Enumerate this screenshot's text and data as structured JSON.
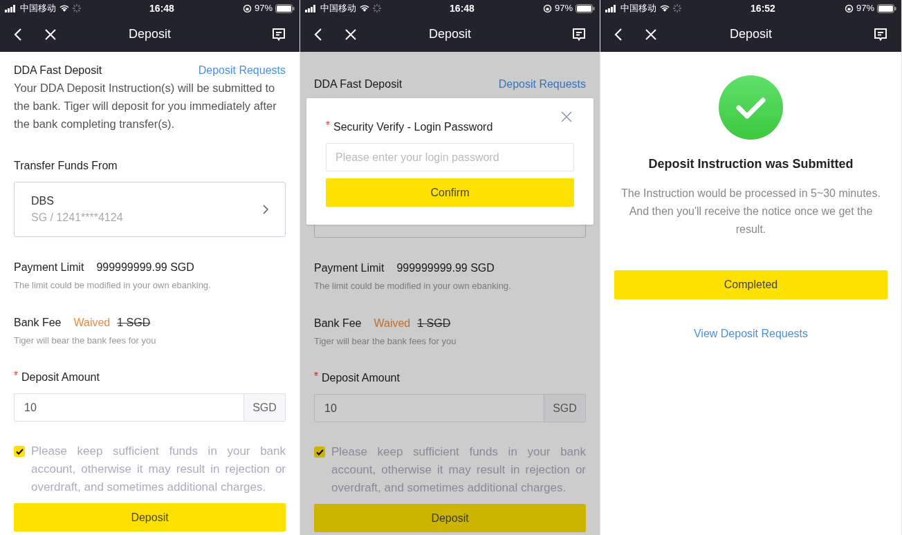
{
  "screens": [
    {
      "kind": "form",
      "status_bar": {
        "carrier": "中国移动",
        "time": "16:48",
        "battery": "97%"
      },
      "nav": {
        "title": "Deposit"
      },
      "header": {
        "title": "DDA Fast Deposit",
        "link": "Deposit Requests"
      },
      "description": "Your DDA Deposit Instruction(s) will be submitted to the bank. Tiger will deposit for you immediately after the bank completing transfer(s).",
      "transfer": {
        "label": "Transfer Funds From",
        "bank": "DBS",
        "account": "SG / 1241****4124"
      },
      "payment_limit": {
        "label": "Payment Limit",
        "value": "999999999.99 SGD",
        "note": "The limit could be modified in your own ebanking."
      },
      "bank_fee": {
        "label": "Bank Fee",
        "waived": "Waived",
        "original": "1 SGD",
        "note": "Tiger will bear the bank fees for you"
      },
      "amount": {
        "label": "Deposit Amount",
        "value": "10",
        "unit": "SGD"
      },
      "agreement": {
        "checked": true,
        "text": "Please keep sufficient funds in your bank account, otherwise it may result in rejection or overdraft, and sometimes additional charges."
      },
      "submit": "Deposit"
    },
    {
      "kind": "form",
      "status_bar": {
        "carrier": "中国移动",
        "time": "16:48",
        "battery": "97%"
      },
      "nav": {
        "title": "Deposit"
      },
      "header": {
        "title": "DDA Fast Deposit",
        "link": "Deposit Requests"
      },
      "payment_limit": {
        "label": "Payment Limit",
        "value": "999999999.99 SGD",
        "note": "The limit could be modified in your own ebanking."
      },
      "bank_fee": {
        "label": "Bank Fee",
        "waived": "Waived",
        "original": "1 SGD",
        "note": "Tiger will bear the bank fees for you"
      },
      "amount": {
        "label": "Deposit Amount",
        "value": "10",
        "unit": "SGD"
      },
      "agreement": {
        "checked": true,
        "text": "Please keep sufficient funds in your bank account, otherwise it may result in rejection or overdraft, and sometimes additional charges."
      },
      "submit": "Deposit",
      "dialog": {
        "title": "Security Verify - Login Password",
        "placeholder": "Please enter your login password",
        "confirm": "Confirm"
      }
    },
    {
      "kind": "success",
      "status_bar": {
        "carrier": "中国移动",
        "time": "16:52",
        "battery": "97%"
      },
      "nav": {
        "title": "Deposit"
      },
      "title": "Deposit Instruction was Submitted",
      "message": "The Instruction would be processed in 5~30 minutes. And then you'll receive the notice once we get the result.",
      "button": "Completed",
      "link": "View Deposit Requests"
    }
  ]
}
